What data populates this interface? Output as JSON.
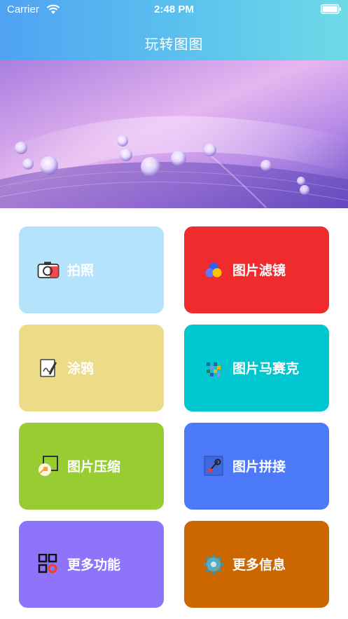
{
  "status_bar": {
    "carrier": "Carrier",
    "time": "2:48 PM",
    "wifi_icon": "wifi-icon",
    "battery_icon": "battery-icon"
  },
  "nav": {
    "title": "玩转图图"
  },
  "banner": {
    "image": "purple-water-drops-photo"
  },
  "tiles": [
    {
      "label": "拍照",
      "icon": "camera-icon",
      "color": "#b5e3fc"
    },
    {
      "label": "图片滤镜",
      "icon": "color-filter-icon",
      "color": "#ef2b2e"
    },
    {
      "label": "涂鸦",
      "icon": "doodle-icon",
      "color": "#ecdb87"
    },
    {
      "label": "图片马赛克",
      "icon": "mosaic-icon",
      "color": "#00c7cf"
    },
    {
      "label": "图片压缩",
      "icon": "compress-icon",
      "color": "#97cc32"
    },
    {
      "label": "图片拼接",
      "icon": "splice-icon",
      "color": "#4c79f8"
    },
    {
      "label": "更多功能",
      "icon": "qr-grid-icon",
      "color": "#8d74fa"
    },
    {
      "label": "更多信息",
      "icon": "gear-icon",
      "color": "#cc6700"
    }
  ],
  "colors": {
    "header_gradient_start": "#4fa3f2",
    "header_gradient_end": "#6cdbe6",
    "tile_text": "#ffffff"
  }
}
